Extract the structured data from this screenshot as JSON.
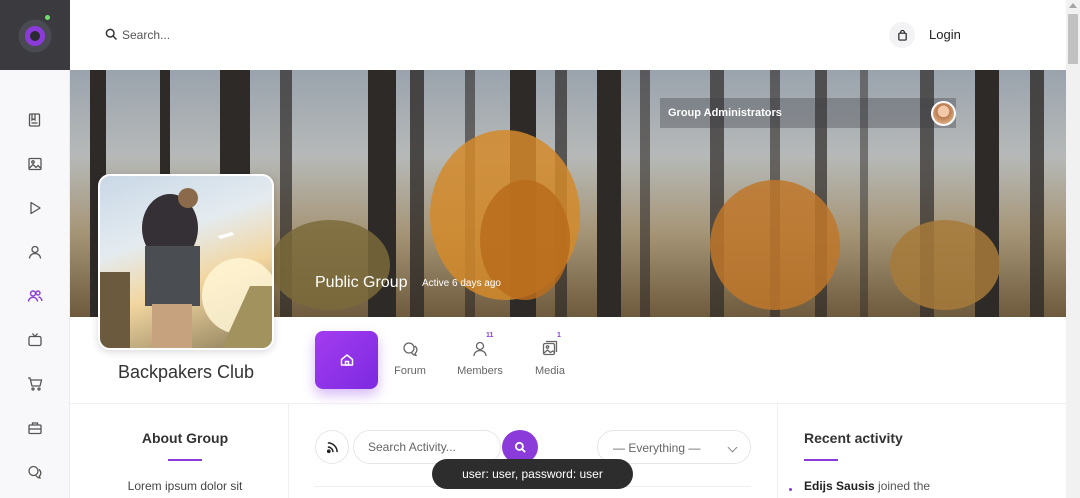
{
  "header": {
    "search_placeholder": "Search...",
    "login_label": "Login"
  },
  "sidebar": {
    "items": [
      {
        "icon": "book-icon",
        "active": false
      },
      {
        "icon": "image-icon",
        "active": false
      },
      {
        "icon": "play-icon",
        "active": false
      },
      {
        "icon": "user-icon",
        "active": false
      },
      {
        "icon": "group-icon",
        "active": true
      },
      {
        "icon": "tv-icon",
        "active": false
      },
      {
        "icon": "cart-icon",
        "active": false
      },
      {
        "icon": "briefcase-icon",
        "active": false
      },
      {
        "icon": "chat-icon",
        "active": false
      }
    ]
  },
  "cover": {
    "admins_label": "Group Administrators",
    "group_type": "Public Group",
    "active_text": "Active 6 days ago"
  },
  "group": {
    "name": "Backpakers Club"
  },
  "tabs": [
    {
      "id": "home",
      "label": "",
      "count": "",
      "active": true
    },
    {
      "id": "forum",
      "label": "Forum",
      "count": ""
    },
    {
      "id": "members",
      "label": "Members",
      "count": "11"
    },
    {
      "id": "media",
      "label": "Media",
      "count": "1"
    }
  ],
  "about": {
    "title": "About Group",
    "text": "Lorem ipsum dolor sit"
  },
  "activity": {
    "search_placeholder": "Search Activity...",
    "filter_value": "— Everything —"
  },
  "recent": {
    "title": "Recent activity",
    "items": [
      {
        "user": "Edijs Sausis",
        "text": " joined the"
      }
    ]
  },
  "toast": {
    "text": "user: user, password: user"
  },
  "colors": {
    "accent": "#8b3bd9",
    "sidebar_bg": "#f8f8fa",
    "logo_bg": "#3a3a3f",
    "toast_bg": "#2d2d2d"
  }
}
